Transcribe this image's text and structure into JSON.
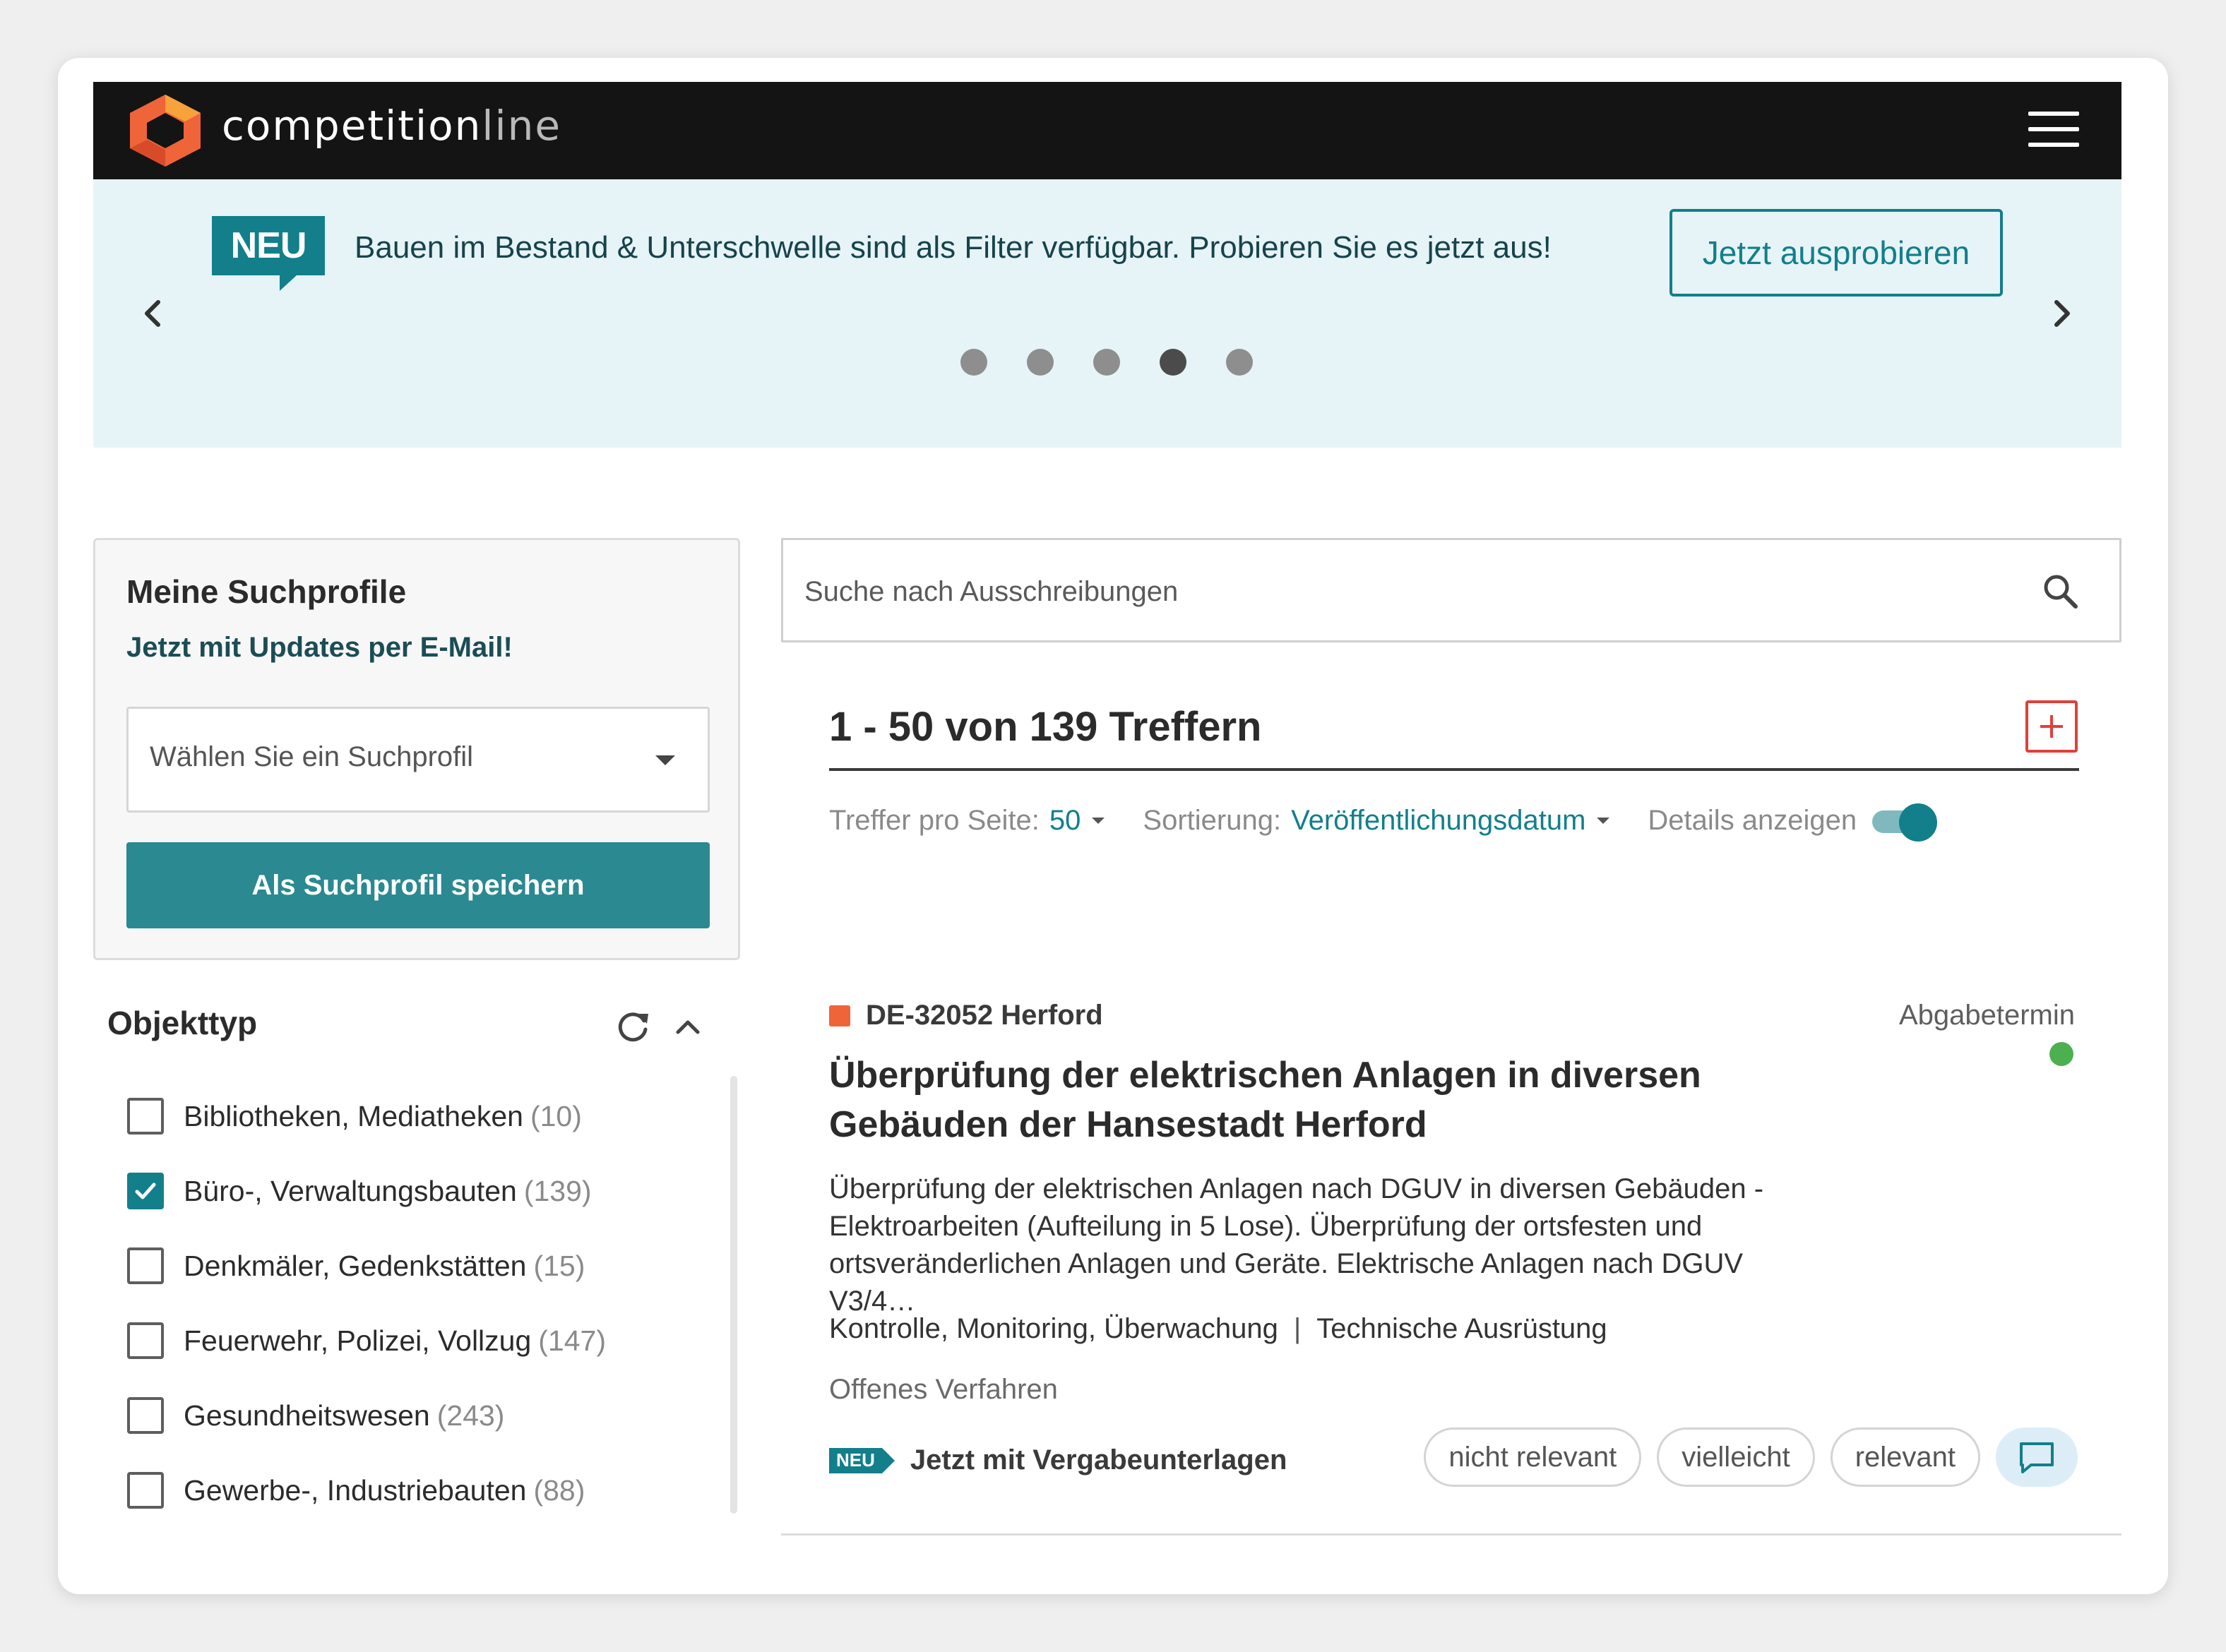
{
  "header": {
    "brand_main": "competition",
    "brand_dim": "line",
    "menu_icon": "hamburger-menu-icon"
  },
  "banner": {
    "badge": "NEU",
    "text": "Bauen im Bestand & Unterschwelle sind als Filter verfügbar. Probieren Sie es jetzt aus!",
    "button": "Jetzt ausprobieren",
    "slide_count": 5,
    "active_slide": 4
  },
  "profile": {
    "title": "Meine Suchprofile",
    "subtitle": "Jetzt mit Updates per E-Mail!",
    "select_placeholder": "Wählen Sie ein Suchprofil",
    "save_button": "Als Suchprofil speichern"
  },
  "facet": {
    "title": "Objekttyp",
    "items": [
      {
        "label": "Bibliotheken, Mediatheken",
        "count": "(10)",
        "checked": false
      },
      {
        "label": "Büro-, Verwaltungsbauten",
        "count": "(139)",
        "checked": true
      },
      {
        "label": "Denkmäler, Gedenkstätten",
        "count": "(15)",
        "checked": false
      },
      {
        "label": "Feuerwehr, Polizei, Vollzug",
        "count": "(147)",
        "checked": false
      },
      {
        "label": "Gesundheitswesen",
        "count": "(243)",
        "checked": false
      },
      {
        "label": "Gewerbe-, Industriebauten",
        "count": "(88)",
        "checked": false
      }
    ]
  },
  "search": {
    "placeholder": "Suche nach Ausschreibungen"
  },
  "results": {
    "title": "1 - 50 von 139 Treffern",
    "per_page_label": "Treffer pro Seite:",
    "per_page_value": "50",
    "sort_label": "Sortierung:",
    "sort_value": "Veröffentlichungsdatum",
    "details_label": "Details anzeigen",
    "details_on": true
  },
  "card": {
    "location": "DE-32052 Herford",
    "deadline_label": "Abgabetermin",
    "title": "Überprüfung der elektrischen Anlagen in diversen Gebäuden der Hansestadt Herford",
    "description": "Überprüfung der elektrischen Anlagen nach DGUV in diversen Gebäuden - Elektroarbeiten (Aufteilung in 5 Lose). Überprüfung der ortsfesten und ortsveränderlichen Anlagen und Geräte. Elektrische Anlagen nach DGUV V3/4…",
    "tag1": "Kontrolle, Monitoring, Überwachung",
    "tag_sep": "|",
    "tag2": "Technische Ausrüstung",
    "procedure": "Offenes Verfahren",
    "neu_badge": "NEU",
    "neu_text": "Jetzt mit Vergabeunterlagen",
    "rating": [
      "nicht relevant",
      "vielleicht",
      "relevant"
    ]
  },
  "colors": {
    "accent": "#127f8b",
    "button": "#2a8991",
    "banner_bg": "#e6f4f7",
    "location_marker": "#f0643a",
    "status_ok": "#4caf50",
    "add_button": "#e0403a"
  }
}
